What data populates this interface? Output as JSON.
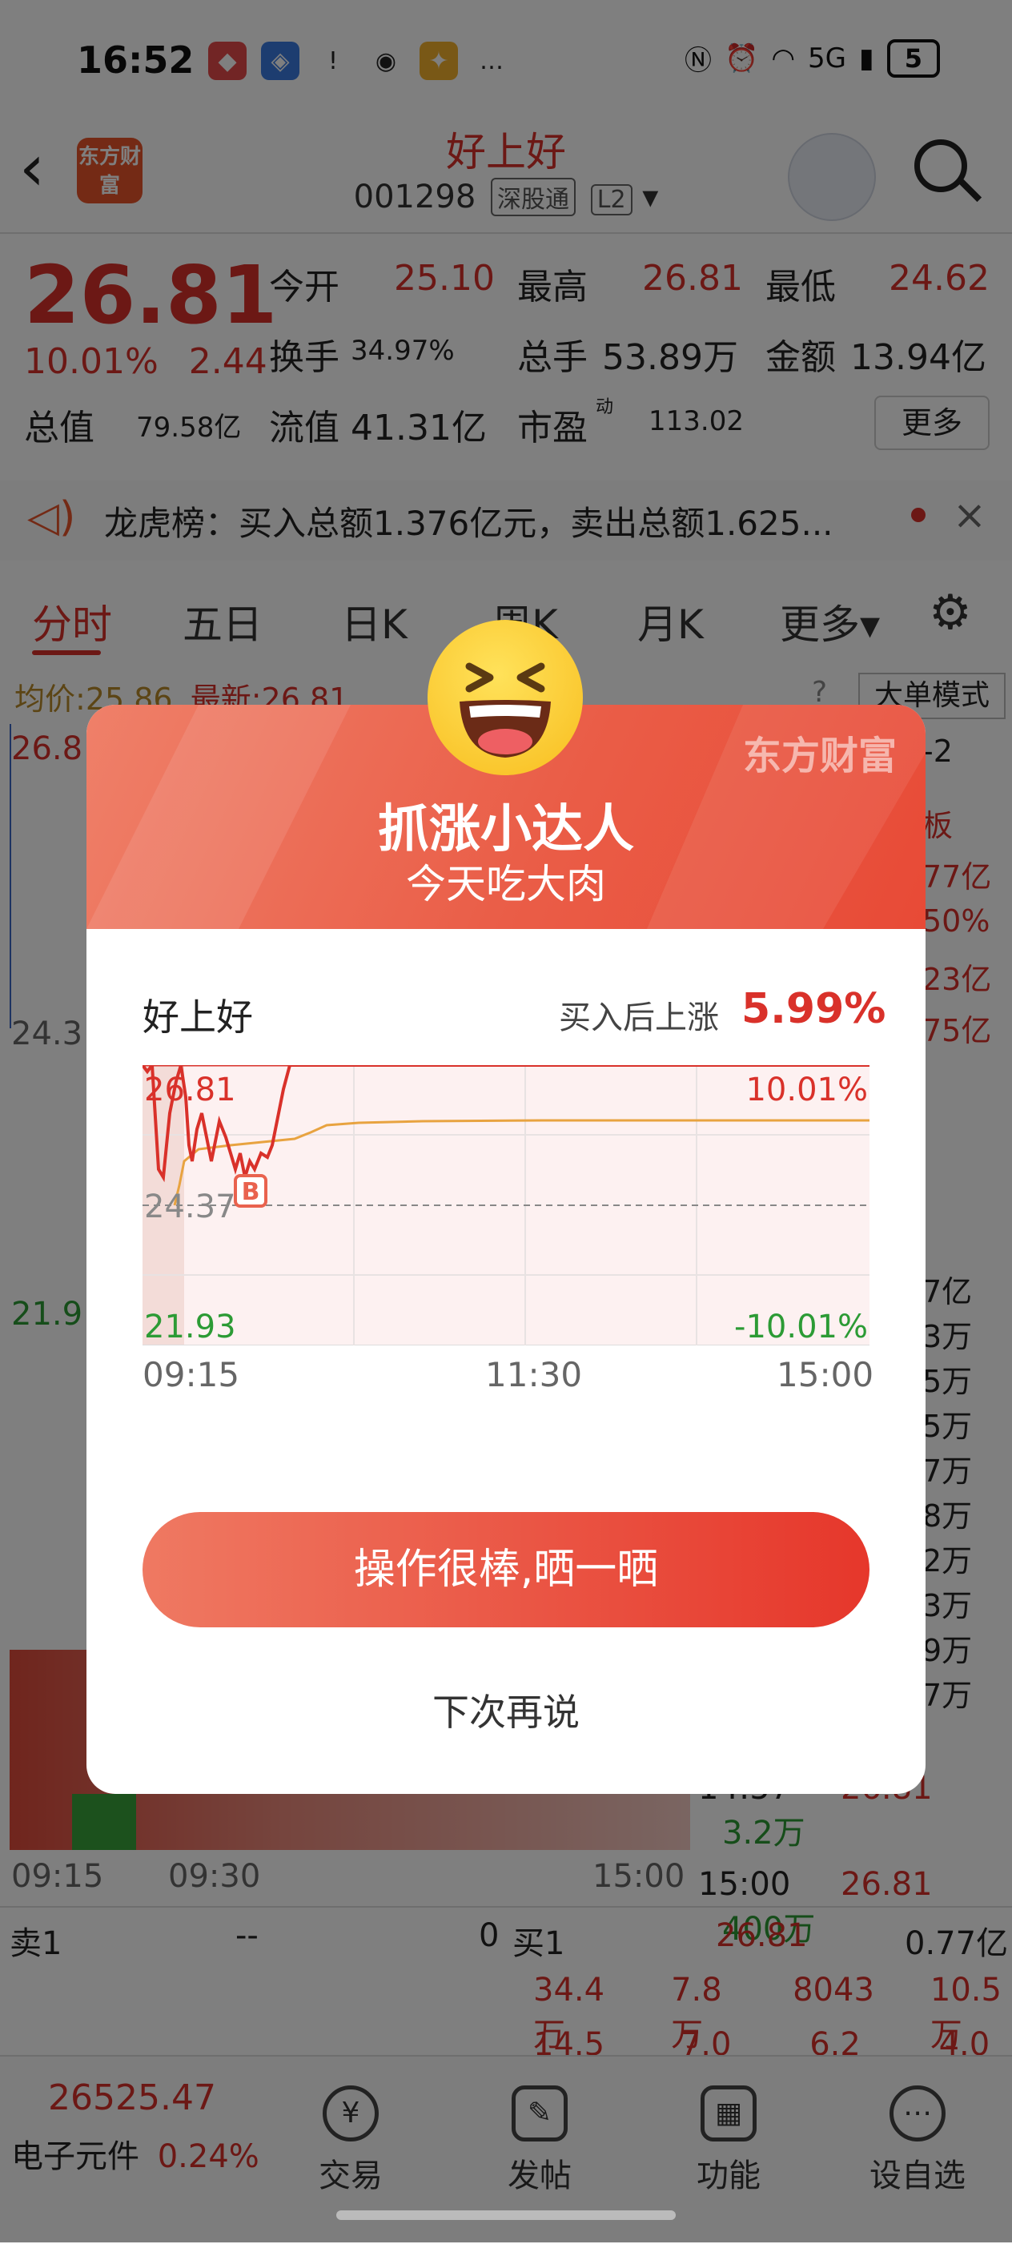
{
  "status_bar": {
    "time": "16:52",
    "network": "5G",
    "battery": "5"
  },
  "header": {
    "logo_text": "东方财富",
    "stock_name": "好上好",
    "stock_code": "001298",
    "tag_connect": "深股通",
    "tag_level": "L2"
  },
  "quote": {
    "price": "26.81",
    "change_pct": "10.01%",
    "change_amt": "2.44",
    "open_label": "今开",
    "open": "25.10",
    "high_label": "最高",
    "high": "26.81",
    "low_label": "最低",
    "low": "24.62",
    "turnover_label": "换手",
    "turnover": "34.97%",
    "volume_label": "总手",
    "volume": "53.89万",
    "amount_label": "金额",
    "amount": "13.94亿",
    "mcap_label": "总值",
    "mcap": "79.58亿",
    "float_label": "流值",
    "float": "41.31亿",
    "pe_label": "市盈",
    "pe_sup": "动",
    "pe": "113.02",
    "more": "更多"
  },
  "banner": {
    "text": "龙虎榜：买入总额1.376亿元，卖出总额1.625..."
  },
  "tabs": [
    "分时",
    "五日",
    "日K",
    "周K",
    "月K",
    "更多▾"
  ],
  "chart_info": {
    "avg_label": "均价:",
    "avg": "25.86",
    "latest_label": "最新:",
    "latest": "26.81",
    "big_order_mode": "大单模式",
    "left_top": "26.8",
    "left_mid": "24.3",
    "left_bottom": "21.9",
    "right_col": [
      "-2",
      "板",
      "77亿",
      "50%",
      "23亿",
      "75亿",
      "7亿",
      "3万",
      "5万",
      "5万",
      "7万",
      "8万",
      "2万",
      "3万",
      "9万",
      "7万"
    ],
    "time_start": "09:15",
    "time_mid": "09:30",
    "time_end": "15:00"
  },
  "ticks": [
    {
      "time": "14:57",
      "price": "26.81",
      "vol": "3.2万"
    },
    {
      "time": "15:00",
      "price": "26.81",
      "vol": "400万"
    }
  ],
  "orderbook": {
    "sell1_label": "卖1",
    "sell1_price": "--",
    "sell1_vol": "0",
    "buy1_label": "买1",
    "buy1_price": "26.81",
    "buy1_vol": "0.77亿",
    "row2": [
      "34.4万",
      "7.8万",
      "8043",
      "10.5万"
    ],
    "row3": [
      "14.5万",
      "7.0万",
      "6.2万",
      "4.0万"
    ]
  },
  "bottom_nav": {
    "index_value": "26525.47",
    "index_name": "电子元件",
    "index_change": "0.24%",
    "items": [
      "交易",
      "发帖",
      "功能",
      "设自选"
    ]
  },
  "modal": {
    "brand": "东方财富",
    "title": "抓涨小达人",
    "subtitle": "今天吃大肉",
    "stock": "好上好",
    "rise_label": "买入后上涨",
    "rise_value": "5.99%",
    "chart_top_price": "26.81",
    "chart_mid_price": "24.37",
    "chart_bottom_price": "21.93",
    "chart_top_pct": "10.01%",
    "chart_bottom_pct": "-10.01%",
    "buy_marker": "B",
    "x_start": "09:15",
    "x_mid": "11:30",
    "x_end": "15:00",
    "share_button": "操作很棒,晒一晒",
    "later_button": "下次再说"
  },
  "colors": {
    "up_red": "#d9312a",
    "down_green": "#2c9b35",
    "modal_gradient_start": "#ef8069",
    "modal_gradient_end": "#e84a36"
  }
}
